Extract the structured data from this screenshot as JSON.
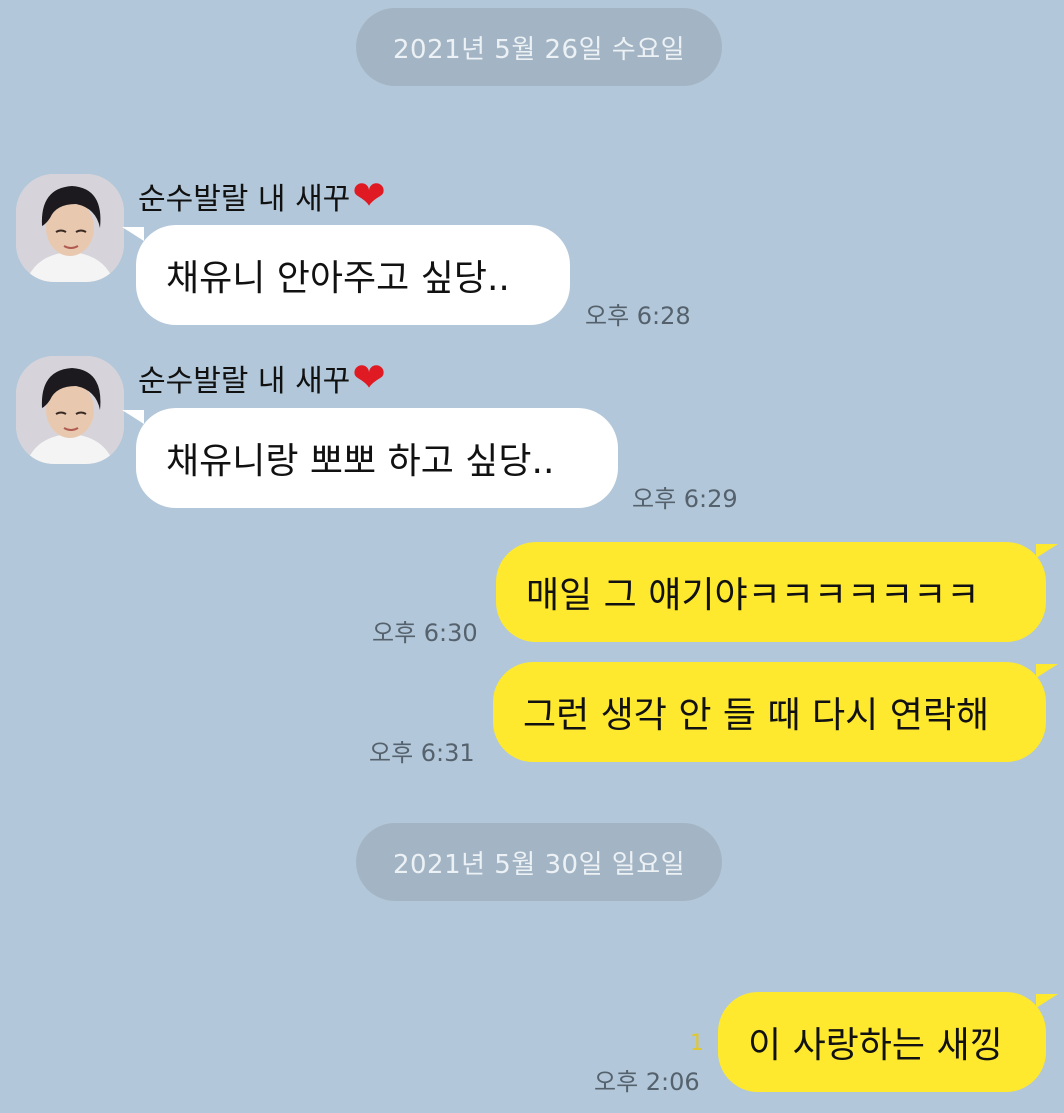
{
  "dates": [
    "2021년 5월 26일 수요일",
    "2021년 5월 30일 일요일"
  ],
  "sender": {
    "name": "순수발랄 내 새꾸",
    "heart": "❤"
  },
  "messages": [
    {
      "text": "채유니 안아주고 싶당..",
      "time": "오후 6:28"
    },
    {
      "text": "채유니랑 뽀뽀 하고 싶당..",
      "time": "오후 6:29"
    },
    {
      "text": "매일 그 얘기야ㅋㅋㅋㅋㅋㅋㅋ",
      "time": "오후 6:30"
    },
    {
      "text": "그런 생각 안 들 때 다시 연락해",
      "time": "오후 6:31"
    },
    {
      "text": "이 사랑하는 새낑",
      "time": "오후 2:06",
      "unread": "1"
    }
  ],
  "colors": {
    "background": "#b2c7d9",
    "my_bubble": "#fee92f",
    "their_bubble": "#ffffff",
    "unread": "#e2c72a"
  }
}
